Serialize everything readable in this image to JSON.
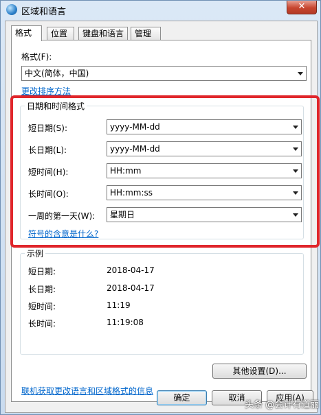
{
  "window": {
    "title": "区域和语言",
    "close_glyph": "✕"
  },
  "tabs": [
    {
      "label": "格式",
      "active": true
    },
    {
      "label": "位置",
      "active": false
    },
    {
      "label": "键盘和语言",
      "active": false
    },
    {
      "label": "管理",
      "active": false
    }
  ],
  "format": {
    "label": "格式(F):",
    "value": "中文(简体，中国)",
    "sort_link": "更改排序方法"
  },
  "datetime": {
    "group_title": "日期和时间格式",
    "rows": [
      {
        "label": "短日期(S):",
        "value": "yyyy-MM-dd"
      },
      {
        "label": "长日期(L):",
        "value": "yyyy-MM-dd"
      },
      {
        "label": "短时间(H):",
        "value": "HH:mm"
      },
      {
        "label": "长时间(O):",
        "value": "HH:mm:ss"
      },
      {
        "label": "一周的第一天(W):",
        "value": "星期日"
      }
    ],
    "help_link": "符号的含意是什么?"
  },
  "examples": {
    "group_title": "示例",
    "rows": [
      {
        "label": "短日期:",
        "value": "2018-04-17"
      },
      {
        "label": "长日期:",
        "value": "2018-04-17"
      },
      {
        "label": "短时间:",
        "value": "11:19"
      },
      {
        "label": "长时间:",
        "value": "11:19:08"
      }
    ]
  },
  "other_settings_button": "其他设置(D)...",
  "online_link": "联机获取更改语言和区域格式的信息",
  "footer": {
    "ok": "确定",
    "cancel": "取消",
    "apply": "应用(A)"
  },
  "watermark": "头条 @会计有道丽",
  "colors": {
    "highlight_box": "#e0262b",
    "link": "#0066cc"
  }
}
